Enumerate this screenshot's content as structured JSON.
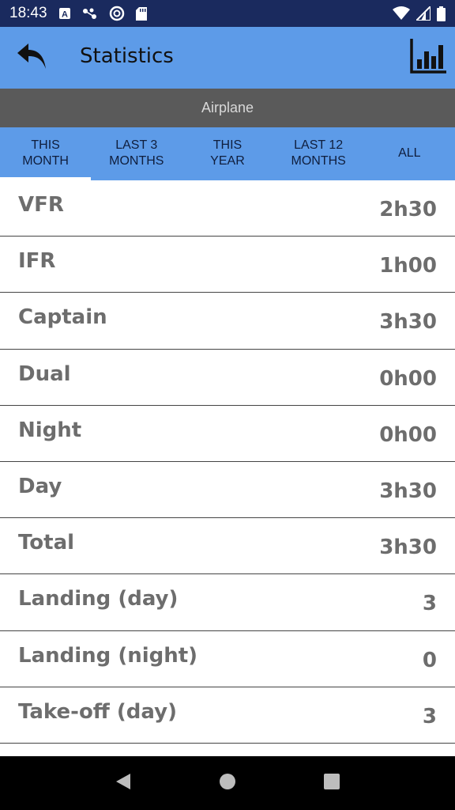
{
  "status_bar": {
    "time": "18:43",
    "icons": [
      "a-notification-icon",
      "connection-icon",
      "sync-icon",
      "sd-card-icon",
      "wifi-icon",
      "signal-icon",
      "battery-icon"
    ]
  },
  "app_bar": {
    "title": "Statistics",
    "back_icon": "back-arrow-icon",
    "chart_icon": "bar-chart-icon"
  },
  "category": "Airplane",
  "tabs": [
    {
      "label": "THIS\nMONTH",
      "active": true
    },
    {
      "label": "LAST 3\nMONTHS",
      "active": false
    },
    {
      "label": "THIS\nYEAR",
      "active": false
    },
    {
      "label": "LAST 12\nMONTHS",
      "active": false
    },
    {
      "label": "ALL",
      "active": false
    }
  ],
  "stats": [
    {
      "label": "VFR",
      "value": "2h30"
    },
    {
      "label": "IFR",
      "value": "1h00"
    },
    {
      "label": "Captain",
      "value": "3h30"
    },
    {
      "label": "Dual",
      "value": "0h00"
    },
    {
      "label": "Night",
      "value": "0h00"
    },
    {
      "label": "Day",
      "value": "3h30"
    },
    {
      "label": "Total",
      "value": "3h30"
    },
    {
      "label": "Landing (day)",
      "value": "3"
    },
    {
      "label": "Landing (night)",
      "value": "0"
    },
    {
      "label": "Take-off (day)",
      "value": "3"
    }
  ],
  "colors": {
    "status_bar": "#1a2a5e",
    "app_bar": "#5d9be8",
    "category_bar": "#5a5a5a",
    "text_gray": "#6d6d6d"
  },
  "nav_bar": {
    "icons": [
      "nav-back-icon",
      "nav-home-icon",
      "nav-recents-icon"
    ]
  }
}
